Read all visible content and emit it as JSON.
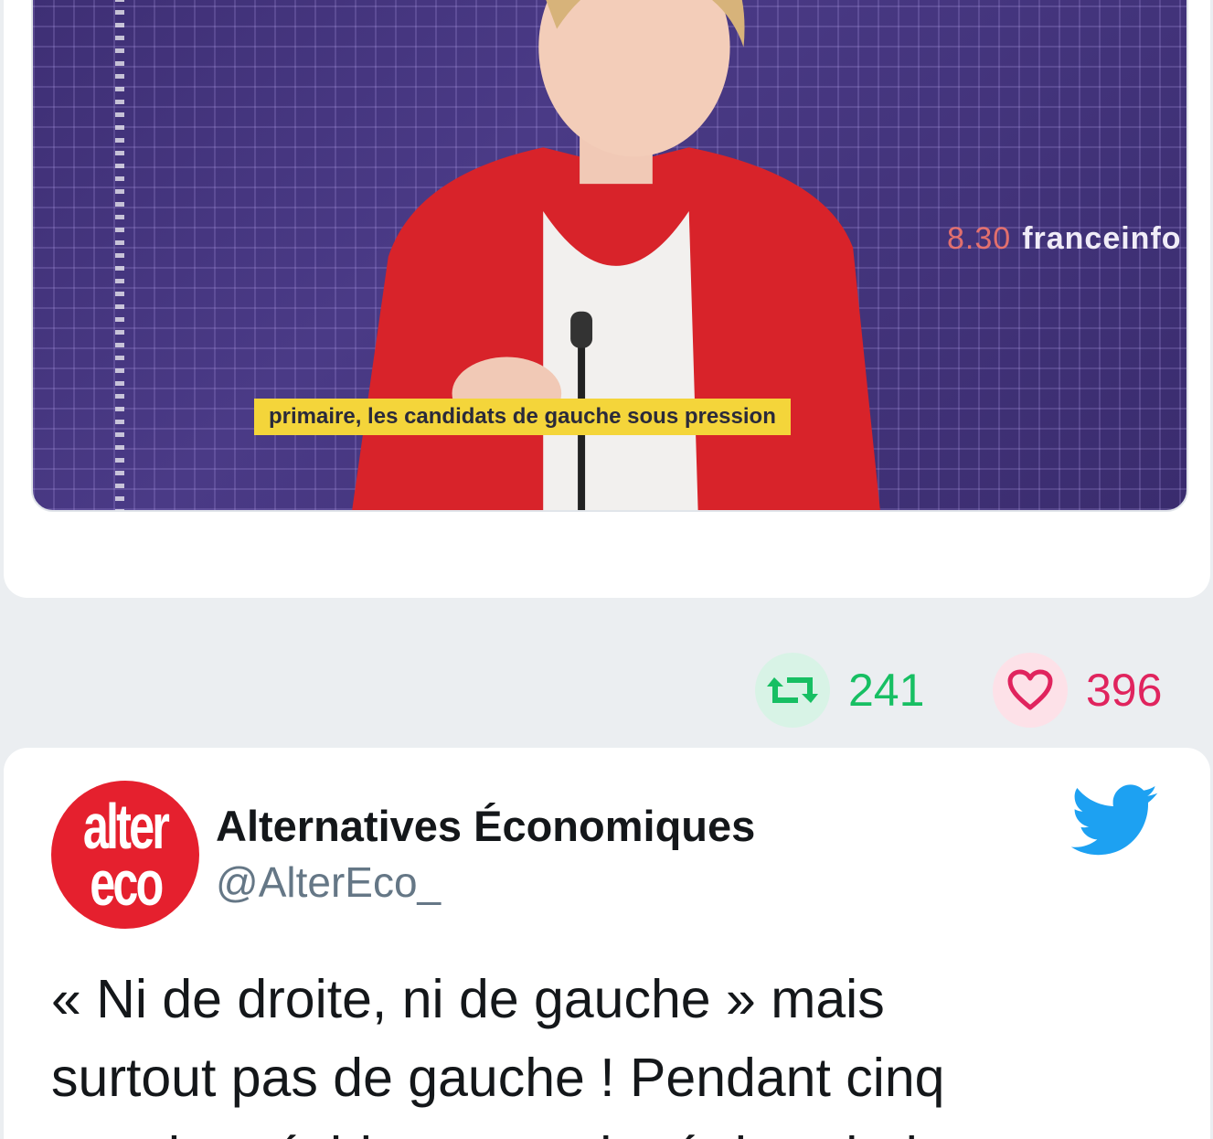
{
  "previous_tweet": {
    "media": {
      "channel_logo": "franceinfo",
      "clock": "8.30",
      "caption": "primaire, les candidats de gauche sous pression"
    },
    "retweets": "241",
    "likes": "396"
  },
  "tweet": {
    "author_name": "Alternatives Économiques",
    "author_handle": "@AlterEco_",
    "avatar_line1": "alter",
    "avatar_line2": "eco",
    "text_line1": "« Ni de droite, ni de gauche » mais",
    "text_line2": "surtout pas de gauche ! Pendant cinq",
    "text_line3": "ans, le président a pratiqué des choix"
  },
  "icons": {
    "retweet": "retweet-icon",
    "like": "heart-icon",
    "platform": "twitter-bird-icon"
  },
  "colors": {
    "background": "#ebeef1",
    "retweet": "#17bf63",
    "like": "#e0245e",
    "twitter_blue": "#1da1f2",
    "avatar_red": "#e5202e",
    "handle_gray": "#657786"
  }
}
